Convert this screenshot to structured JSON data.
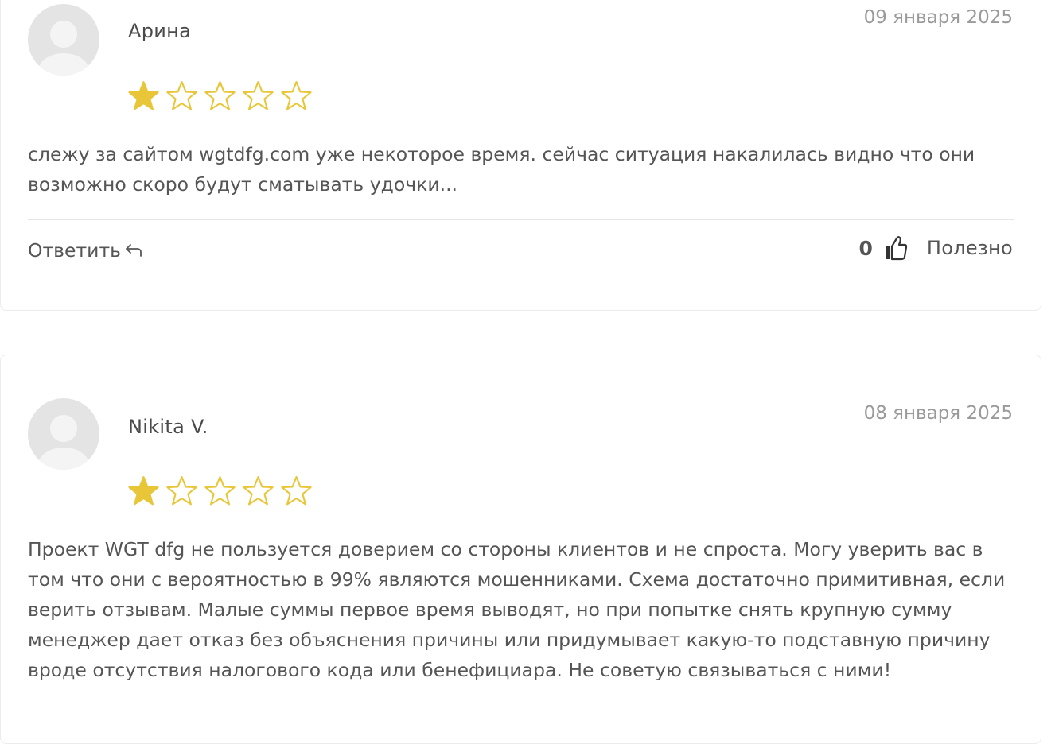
{
  "reviews": [
    {
      "author": "Арина",
      "date": "09 января 2025",
      "rating": 1,
      "max_rating": 5,
      "text": "слежу за сайтом wgtdfg.com уже некоторое время. сейчас ситуация накалилась видно что они возможно скоро будут сматывать удочки...",
      "reply_label": "Ответить",
      "likes": "0",
      "useful_label": "Полезно"
    },
    {
      "author": "Nikita V.",
      "date": "08 января 2025",
      "rating": 1,
      "max_rating": 5,
      "text": "Проект WGT dfg не пользуется доверием со стороны клиентов и не спроста. Могу уверить вас в том что они с вероятностью в 99% являются мошенниками. Схема достаточно примитивная, если верить отзывам. Малые суммы первое время выводят, но при попытке снять крупную сумму менеджер дает отказ без объяснения причины или придумывает какую-то подставную причину вроде отсутствия налогового кода или бенефициара. Не советую связываться с ними!"
    }
  ],
  "colors": {
    "star_filled": "#E8C638",
    "star_empty_stroke": "#E8C638",
    "avatar_bg": "#E4E4E4",
    "avatar_fg": "#FFFFFF",
    "border": "#ECECEC"
  },
  "icons": {
    "avatar": "user-silhouette-icon",
    "star_filled": "star-filled-icon",
    "star_empty": "star-outline-icon",
    "reply": "reply-arrow-icon",
    "like": "thumbs-up-icon"
  }
}
